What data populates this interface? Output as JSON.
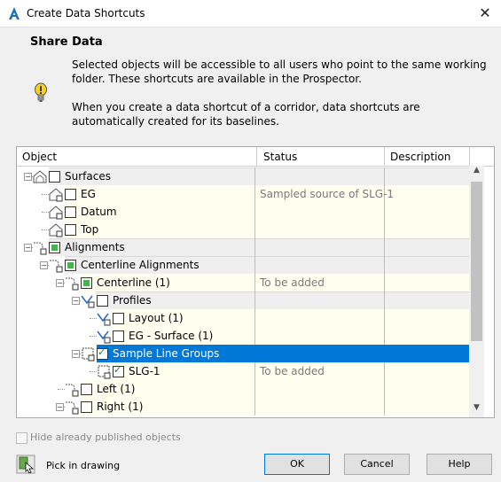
{
  "window": {
    "title": "Create Data Shortcuts",
    "close_glyph": "✕"
  },
  "header": {
    "heading": "Share Data",
    "info1": "Selected objects will be accessible to all users who point to the same working folder. These shortcuts are available in the Prospector.",
    "info2": "When you create a data shortcut of a corridor, data shortcuts are automatically created for its baselines."
  },
  "table": {
    "columns": [
      "Object",
      "Status",
      "Description"
    ],
    "rows": [
      {
        "label": "Surfaces",
        "status": "",
        "check": "none",
        "icon": "surface-group-icon",
        "level": 0,
        "expander": "minus",
        "band": "gray"
      },
      {
        "label": "EG",
        "status": "Sampled source of SLG-1",
        "check": "none",
        "icon": "surface-icon",
        "level": 1,
        "band": "yellow"
      },
      {
        "label": "Datum",
        "status": "",
        "check": "none",
        "icon": "surface-icon",
        "level": 1,
        "band": "yellow"
      },
      {
        "label": "Top",
        "status": "",
        "check": "none",
        "icon": "surface-icon",
        "level": 1,
        "band": "yellow"
      },
      {
        "label": "Alignments",
        "status": "",
        "check": "partial",
        "icon": "alignment-group-icon",
        "level": 0,
        "expander": "minus",
        "band": "gray"
      },
      {
        "label": "Centerline Alignments",
        "status": "",
        "check": "partial",
        "icon": "alignment-group-icon",
        "level": 1,
        "expander": "minus",
        "band": "gray"
      },
      {
        "label": "Centerline (1)",
        "status": "To be added",
        "check": "partial",
        "icon": "alignment-icon",
        "level": 2,
        "expander": "minus",
        "band": "yellow"
      },
      {
        "label": "Profiles",
        "status": "",
        "check": "none",
        "icon": "profile-group-icon",
        "level": 3,
        "expander": "minus",
        "band": "gray"
      },
      {
        "label": "Layout (1)",
        "status": "",
        "check": "none",
        "icon": "profile-icon",
        "level": 4,
        "band": "yellow"
      },
      {
        "label": "EG - Surface (1)",
        "status": "",
        "check": "none",
        "icon": "profile-icon",
        "level": 4,
        "band": "yellow"
      },
      {
        "label": "Sample Line Groups",
        "status": "",
        "check": "checked",
        "icon": "sample-line-group-icon",
        "level": 3,
        "expander": "minus",
        "band": "selected"
      },
      {
        "label": "SLG-1",
        "status": "To be added",
        "check": "checked",
        "icon": "sample-line-icon",
        "level": 4,
        "band": "yellow"
      },
      {
        "label": "Left (1)",
        "status": "",
        "check": "none",
        "icon": "alignment-icon",
        "level": 2,
        "band": "yellow"
      },
      {
        "label": "Right (1)",
        "status": "",
        "check": "none",
        "icon": "alignment-icon",
        "level": 2,
        "expander": "minus",
        "band": "yellow"
      }
    ]
  },
  "footer": {
    "hide_label": "Hide already published objects",
    "pick_label": "Pick in drawing",
    "ok": "OK",
    "cancel": "Cancel",
    "help": "Help"
  },
  "colors": {
    "selected": "#0078d7",
    "yellow_band": "#fffff0",
    "gray_band": "#efefef",
    "redline": "#e7a8b4"
  }
}
